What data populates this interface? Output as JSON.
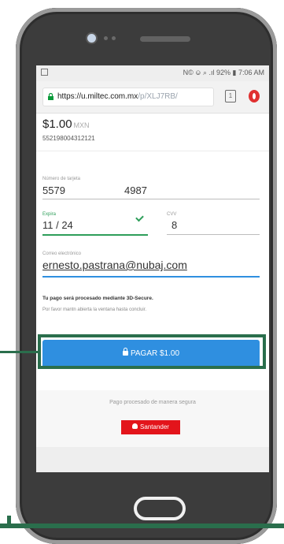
{
  "status": {
    "right": "N© ⎉ ⌕ .ıl 92% ▮ 7:06 AM"
  },
  "browser": {
    "url_host": "https://u.miltec.com.mx",
    "url_path": "/p/XLJ7RB/",
    "tab_count": "1"
  },
  "payment": {
    "amount": "$1.00",
    "currency": "MXN",
    "reference": "552198004312121",
    "card_label": "Número de tarjeta",
    "card_part1": "5579",
    "card_part2": "4987",
    "expiry_label": "Expira",
    "expiry": "11 / 24",
    "cvv_label": "CVV",
    "cvv": "8",
    "email_label": "Correo electrónico",
    "email": "ernesto.pastrana@nubaj.com",
    "note_bold": "Tu pago será procesado mediante 3D-Secure.",
    "note": "Por favor mantn abierta la ventana hasta concluir.",
    "pay_button": "PAGAR $1.00"
  },
  "footer": {
    "text": "Pago procesado de manera segura",
    "bank": "Santander"
  },
  "colors": {
    "accent": "#2f8fe0",
    "callout": "#2a6e4c",
    "bank": "#e3141b"
  }
}
